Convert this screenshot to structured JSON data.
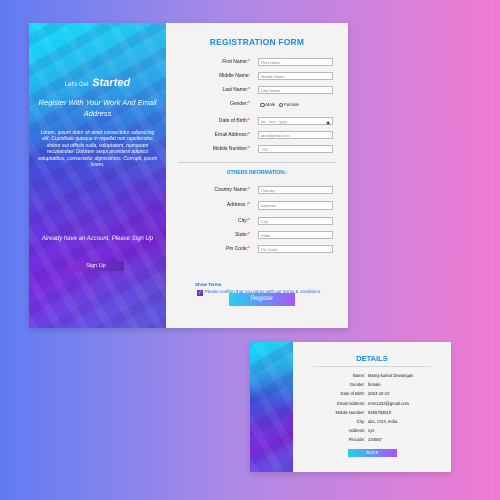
{
  "colors": {
    "accent": "#1a8be0",
    "required": "#e0233b",
    "link": "#1a6fe0",
    "button_from": "#22d3ee",
    "button_to": "#a855f7"
  },
  "side": {
    "lets": "Let's Get",
    "started": "Started",
    "heading": "Register With Your Work And Email Address",
    "lorem": "Lorem, ipsum dolor sit amet consectetur adipisicing elit. Cupiditate quisque in repellat non repellendus dolore aut officiis nulla, voluptatem, numquam recusandae! Dolorem sequi provident adipisci voluptatibus, consectetur dignissimos. Corrupti, ipsum lorem.",
    "account_text": "Already have an Account, Please Sign Up",
    "signup_label": "Sign Up"
  },
  "form": {
    "title": "REGISTRATION FORM",
    "fields": {
      "first_name": {
        "label": "First Name:",
        "req": "*",
        "placeholder": "First Name"
      },
      "middle_name": {
        "label": "Middle Name:",
        "req": "",
        "placeholder": "Middle Name"
      },
      "last_name": {
        "label": "Last Name:",
        "req": "*",
        "placeholder": "Last Name"
      },
      "gender": {
        "label": "Gender:",
        "req": "*",
        "opt1": "Male",
        "opt2": "Female"
      },
      "dob": {
        "label": "Date of Birth:",
        "req": "*",
        "placeholder": "dd - mm - yyyy"
      },
      "email": {
        "label": "Email Address:",
        "req": "*",
        "placeholder": "abc@gmail.com"
      },
      "mobile": {
        "label": "Mobile Number:",
        "req": "*",
        "placeholder": "+91"
      }
    },
    "others_title": "OTHERS INFORMATION:-",
    "others": {
      "country": {
        "label": "Country Name:",
        "req": "*",
        "placeholder": "Country"
      },
      "address": {
        "label": "Address :",
        "req": "*",
        "placeholder": "Address"
      },
      "city": {
        "label": "City:",
        "req": "*",
        "placeholder": "City"
      },
      "state": {
        "label": "State:",
        "req": "*",
        "placeholder": "State"
      },
      "pincode": {
        "label": "Pin Code:",
        "req": "*",
        "placeholder": "Pin Code"
      }
    },
    "show_terms": "Show Terms",
    "terms_text": "Please confirm that you agree with our terms & conditions.",
    "register_label": "Register",
    "calendar_icon": "calendar-icon",
    "check_icon": "checkmark-icon"
  },
  "details": {
    "title": "DETAILS",
    "rows": [
      {
        "k": "Name:",
        "v": "Manoj kumar Dewangan"
      },
      {
        "k": "Gender:",
        "v": "female"
      },
      {
        "k": "Date of Birth:",
        "v": "2024-10-10"
      },
      {
        "k": "Email Address:",
        "v": "mrm1234@gmail.com"
      },
      {
        "k": "Mobile Number:",
        "v": "9455782510"
      },
      {
        "k": "City:",
        "v": "abc, CG4, India"
      },
      {
        "k": "Address:",
        "v": "xyz"
      },
      {
        "k": "Pincode:",
        "v": "234567"
      }
    ],
    "back_label": "BACK"
  }
}
